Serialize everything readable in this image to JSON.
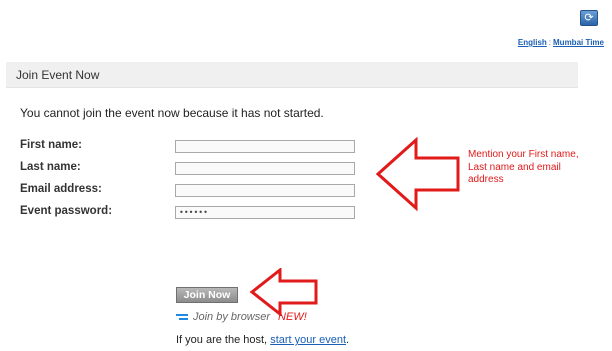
{
  "header": {
    "refresh_icon": "refresh-icon",
    "language_link": "English",
    "separator": ":",
    "timezone_link": "Mumbai Time"
  },
  "panel": {
    "title": "Join Event Now"
  },
  "notice": "You cannot join the event now because it has not started.",
  "form": {
    "first_name_label": "First name:",
    "last_name_label": "Last name:",
    "email_label": "Email address:",
    "password_label": "Event password:",
    "first_name_value": "",
    "last_name_value": "",
    "email_value": "",
    "password_value": "••••••"
  },
  "annotation": {
    "hint_text": "Mention your First name, Last name and email address",
    "color": "#e11a1a"
  },
  "actions": {
    "join_label": "Join Now",
    "browser_label": "Join by browser",
    "new_badge": "NEW!",
    "host_prefix": "If you are the host,",
    "host_link": "start your event",
    "host_suffix": "."
  }
}
